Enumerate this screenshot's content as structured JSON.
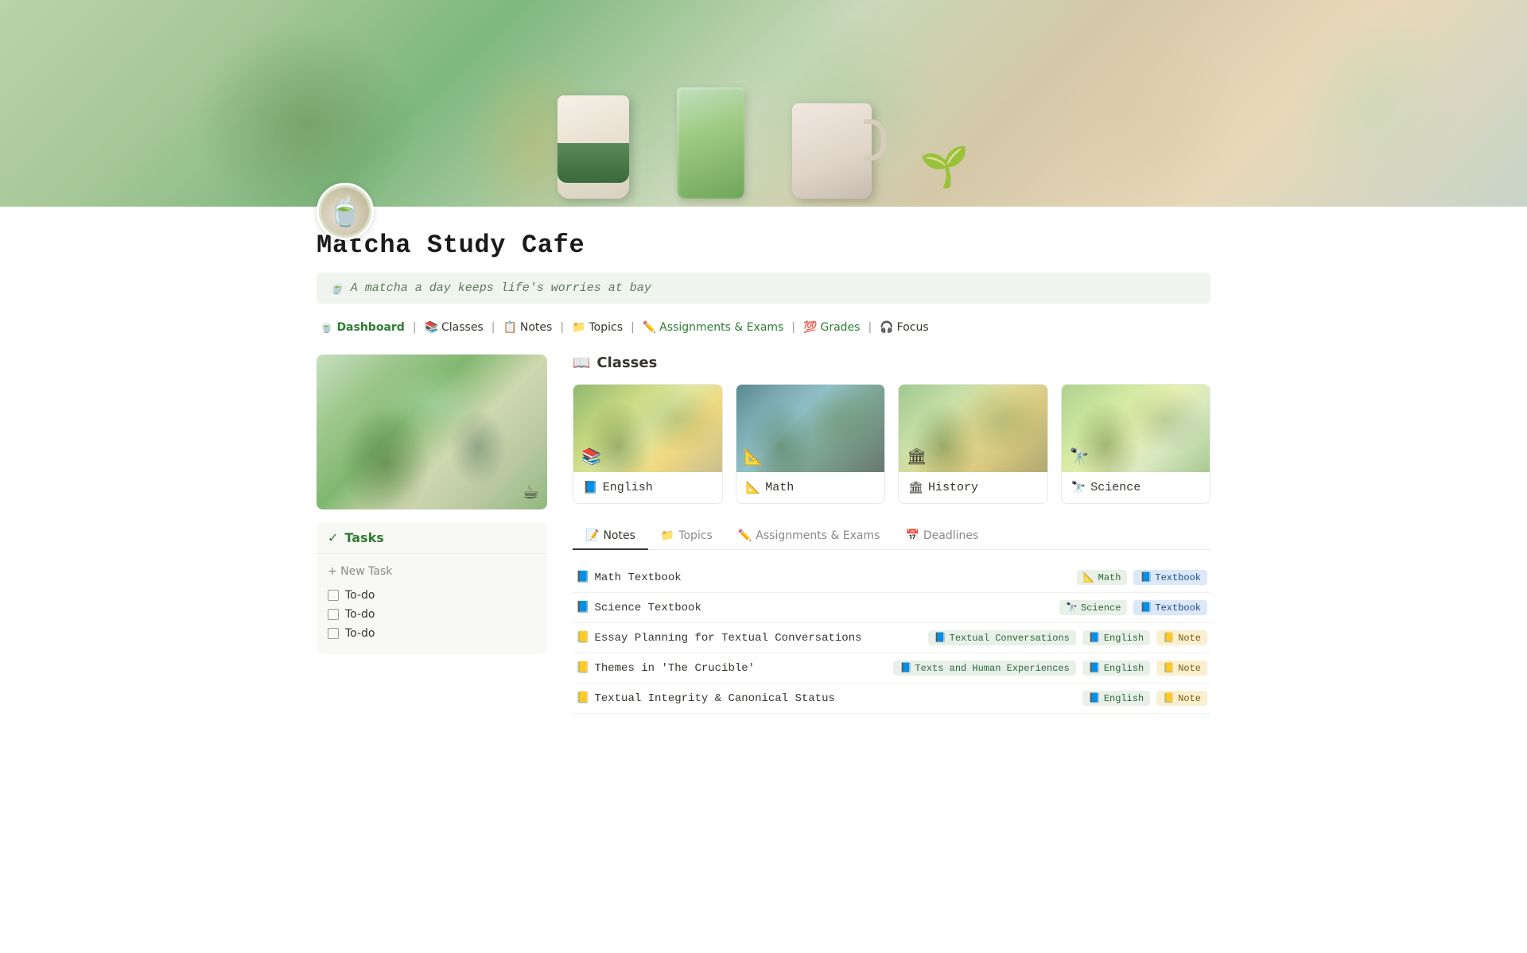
{
  "hero": {
    "alt": "Matcha study cafe hero banner with anime-style illustration"
  },
  "avatar": {
    "emoji": "🍵",
    "alt": "Matcha cup avatar"
  },
  "page": {
    "title": "Matcha Study Cafe"
  },
  "quote": {
    "emoji": "🍵",
    "text": "A matcha a day keeps life's worries at bay"
  },
  "nav": {
    "items": [
      {
        "id": "dashboard",
        "emoji": "🍵",
        "label": "Dashboard",
        "active": true
      },
      {
        "id": "classes",
        "emoji": "📚",
        "label": "Classes",
        "active": false
      },
      {
        "id": "notes",
        "emoji": "📋",
        "label": "Notes",
        "active": false
      },
      {
        "id": "topics",
        "emoji": "📁",
        "label": "Topics",
        "active": false
      },
      {
        "id": "assignments",
        "emoji": "✏️",
        "label": "Assignments & Exams",
        "active": false
      },
      {
        "id": "grades",
        "emoji": "💯",
        "label": "Grades",
        "active": false
      },
      {
        "id": "focus",
        "emoji": "🎧",
        "label": "Focus",
        "active": false
      }
    ]
  },
  "tasks": {
    "title": "Tasks",
    "new_task_label": "+ New Task",
    "items": [
      {
        "label": "To-do",
        "done": false
      },
      {
        "label": "To-do",
        "done": false
      },
      {
        "label": "To-do",
        "done": false
      }
    ]
  },
  "classes_section": {
    "title": "Classes",
    "emoji": "📖",
    "items": [
      {
        "id": "english",
        "label": "English",
        "emoji": "📘",
        "theme": "english"
      },
      {
        "id": "math",
        "label": "Math",
        "emoji": "📐",
        "theme": "math"
      },
      {
        "id": "history",
        "label": "History",
        "emoji": "🏛",
        "theme": "history"
      },
      {
        "id": "science",
        "label": "Science",
        "emoji": "🔭",
        "theme": "science"
      }
    ]
  },
  "tabs": [
    {
      "id": "notes",
      "emoji": "📝",
      "label": "Notes",
      "active": true
    },
    {
      "id": "topics",
      "emoji": "📁",
      "label": "Topics",
      "active": false
    },
    {
      "id": "assignments",
      "emoji": "✏️",
      "label": "Assignments & Exams",
      "active": false
    },
    {
      "id": "deadlines",
      "emoji": "📅",
      "label": "Deadlines",
      "active": false
    }
  ],
  "notes": [
    {
      "title": "Math Textbook",
      "title_emoji": "📘",
      "subject": "Math",
      "subject_emoji": "📐",
      "type": "Textbook",
      "type_color": "blue"
    },
    {
      "title": "Science Textbook",
      "title_emoji": "📘",
      "subject": "Science",
      "subject_emoji": "🔭",
      "type": "Textbook",
      "type_color": "blue"
    },
    {
      "title": "Essay Planning for Textual Conversations",
      "title_emoji": "📒",
      "topic": "Textual Conversations",
      "topic_emoji": "📘",
      "subject": "English",
      "subject_emoji": "📘",
      "type": "Note",
      "type_color": "yellow"
    },
    {
      "title": "Themes in 'The Crucible'",
      "title_emoji": "📒",
      "topic": "Texts and Human Experiences",
      "topic_emoji": "📘",
      "subject": "English",
      "subject_emoji": "📘",
      "type": "Note",
      "type_color": "yellow"
    },
    {
      "title": "Textual Integrity & Canonical Status",
      "title_emoji": "📒",
      "subject": "English",
      "subject_emoji": "📘",
      "type": "Note",
      "type_color": "yellow"
    }
  ]
}
